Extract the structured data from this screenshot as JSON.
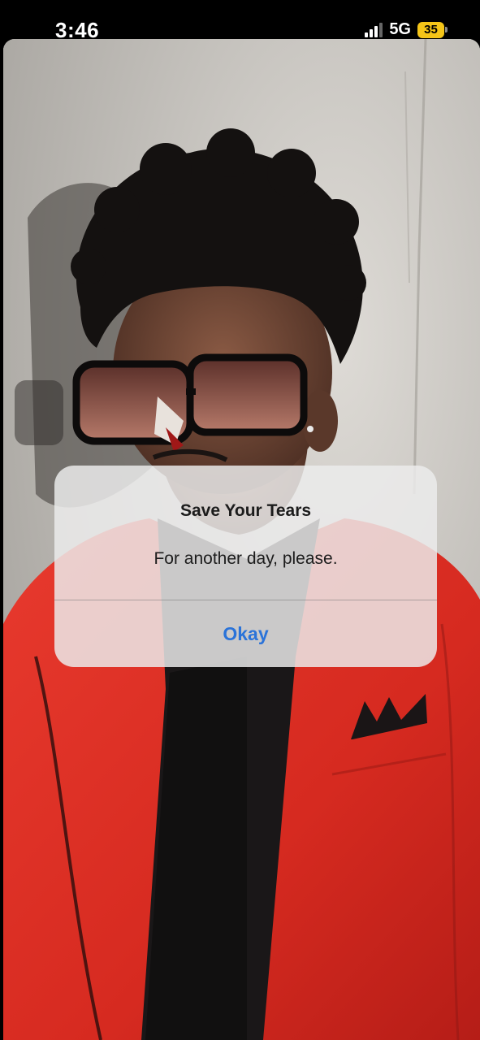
{
  "status_bar": {
    "time": "3:46",
    "network": "5G",
    "battery_level": "35",
    "battery_color": "#f5c518"
  },
  "alert": {
    "title": "Save Your Tears",
    "message": "For another day, please.",
    "button_label": "Okay",
    "button_color": "#2a73d9"
  }
}
